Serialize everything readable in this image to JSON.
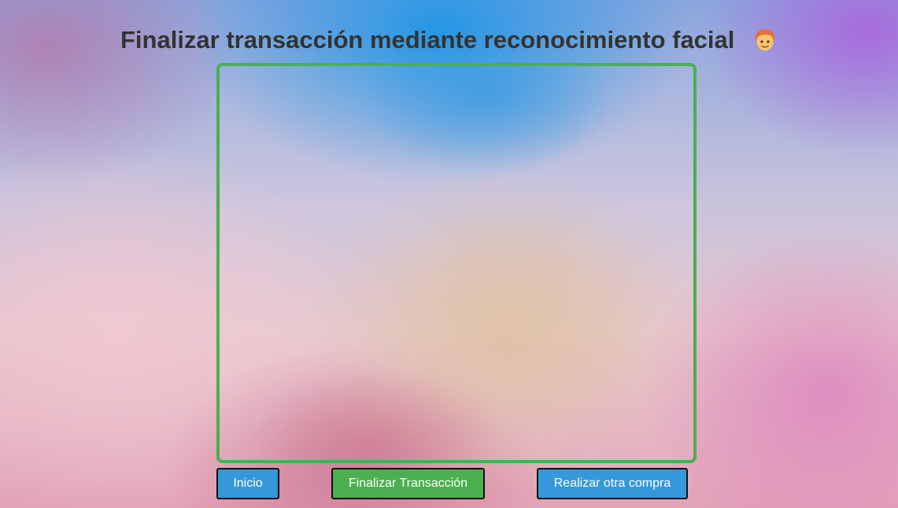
{
  "page": {
    "title": "Finalizar transacción mediante reconocimiento facial",
    "title_icon": "person-face-emoji-icon"
  },
  "camera": {
    "frame_color": "#4caf50"
  },
  "buttons": {
    "home_label": "Inicio",
    "finalize_label": "Finalizar Transacción",
    "another_purchase_label": "Realizar otra compra"
  },
  "colors": {
    "primary_blue": "#3498db",
    "success_green": "#4caf50",
    "title_text": "#333333"
  }
}
